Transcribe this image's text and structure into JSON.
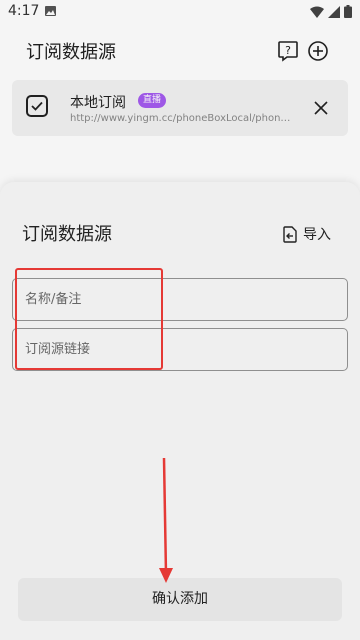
{
  "status_bar": {
    "time": "4:17",
    "icons": [
      "image-icon",
      "wifi-icon",
      "signal-icon",
      "battery-icon"
    ]
  },
  "header": {
    "title": "订阅数据源",
    "icons": [
      "help-icon",
      "add-circle-icon"
    ]
  },
  "subscription": {
    "name": "本地订阅",
    "badge": "直播",
    "url": "http://www.yingm.cc/phoneBoxLocal/phoneBoxLocal.json",
    "badge_color": "#a55cf0"
  },
  "sheet": {
    "title": "订阅数据源",
    "import_label": "导入",
    "name_input": {
      "placeholder": "名称/备注",
      "value": ""
    },
    "url_input": {
      "placeholder": "订阅源链接",
      "value": ""
    },
    "confirm_label": "确认添加"
  },
  "annotation_color": "#e53935"
}
